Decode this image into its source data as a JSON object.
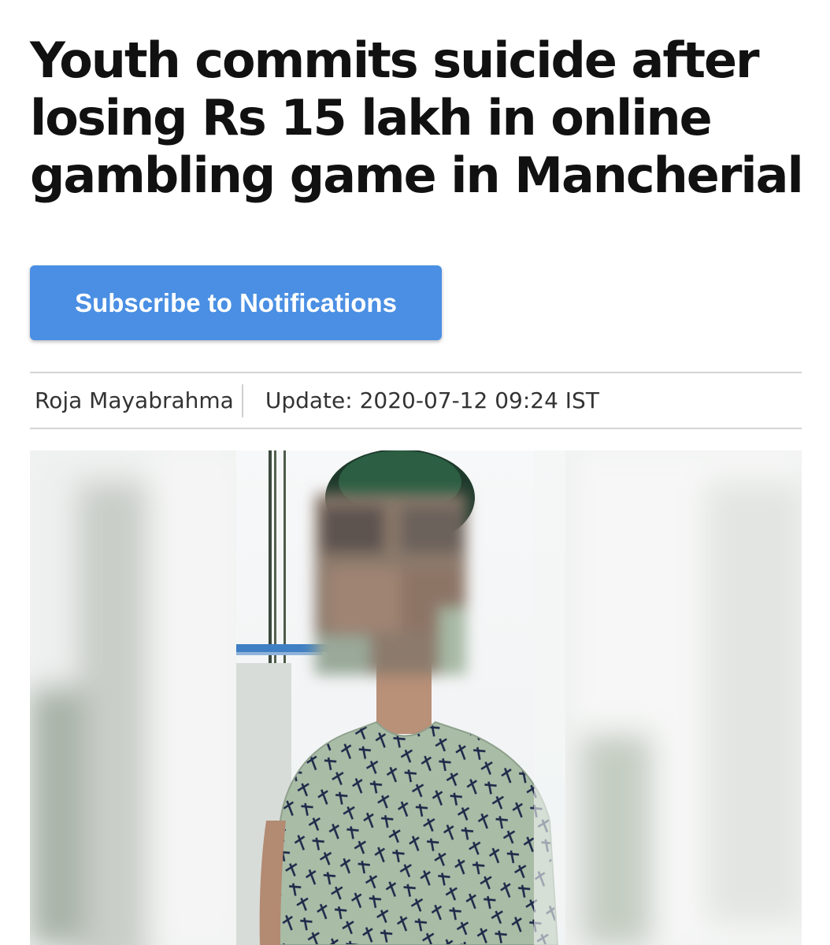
{
  "article": {
    "headline": "Youth commits suicide after losing Rs 15 lakh in online gambling game in Mancherial",
    "subscribe_label": "Subscribe to Notifications",
    "author": "Roja Mayabrahma",
    "update_label": "Update: 2020-07-12 09:24 IST"
  },
  "colors": {
    "subscribe_button": "#4a8fe3",
    "headline_text": "#111111",
    "divider": "#d4d4d4",
    "shirt": "#a6b9a3"
  }
}
